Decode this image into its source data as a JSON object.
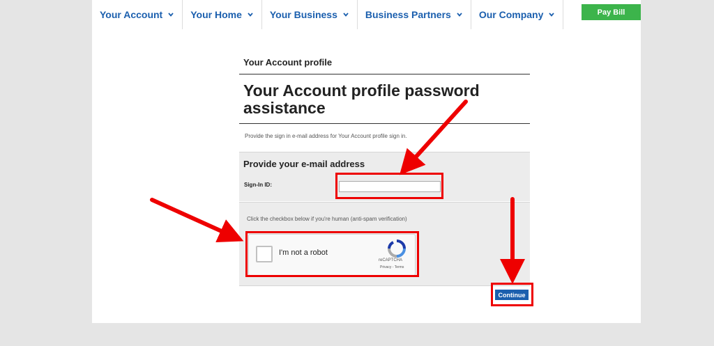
{
  "nav": {
    "items": [
      {
        "label": "Your Account"
      },
      {
        "label": "Your Home"
      },
      {
        "label": "Your Business"
      },
      {
        "label": "Business Partners"
      },
      {
        "label": "Our Company"
      }
    ],
    "pay_bill": "Pay Bill"
  },
  "page": {
    "breadcrumb": "Your Account profile",
    "title": "Your Account profile password assistance",
    "instruction": "Provide the sign in e-mail address for Your Account profile sign in.",
    "email_section": {
      "heading": "Provide your e-mail address",
      "signin_label": "Sign-In ID:",
      "signin_value": ""
    },
    "captcha_section": {
      "note": "Click the checkbox below if you're human (anti-spam verification)",
      "checkbox_label": "I'm not a robot",
      "brand": "reCAPTCHA",
      "links": "Privacy - Terms"
    },
    "continue_label": "Continue"
  },
  "colors": {
    "accent": "#1b5fae",
    "pay_bill": "#3cb44b",
    "highlight": "#e00000",
    "background": "#e5e5e5"
  }
}
